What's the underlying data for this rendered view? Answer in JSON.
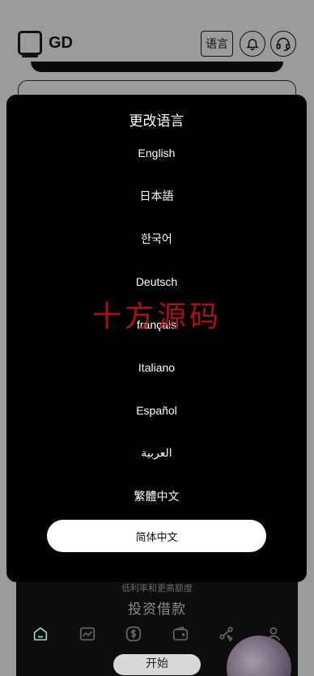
{
  "header": {
    "brand": "GD",
    "language_button": "语言"
  },
  "background": {
    "sub_slogan": "低利率和更高额度",
    "main_slogan": "投资借款",
    "start_button": "开始"
  },
  "tabbar": {
    "icons": [
      "home-icon",
      "chart-icon",
      "dollar-icon",
      "wallet-icon",
      "share-icon",
      "user-icon"
    ]
  },
  "modal": {
    "title": "更改语言",
    "languages": [
      {
        "label": "English"
      },
      {
        "label": "日本語"
      },
      {
        "label": "한국어"
      },
      {
        "label": "Deutsch"
      },
      {
        "label": "français"
      },
      {
        "label": "Italiano"
      },
      {
        "label": "Español"
      },
      {
        "label": "العربية"
      },
      {
        "label": "繁體中文"
      },
      {
        "label": "简体中文",
        "selected": true
      }
    ]
  },
  "watermark": "十方源码",
  "colors": {
    "modal_bg": "#000000",
    "page_bg": "#9b9b9b",
    "selected_bg": "#ffffff",
    "watermark": "#c81414"
  }
}
